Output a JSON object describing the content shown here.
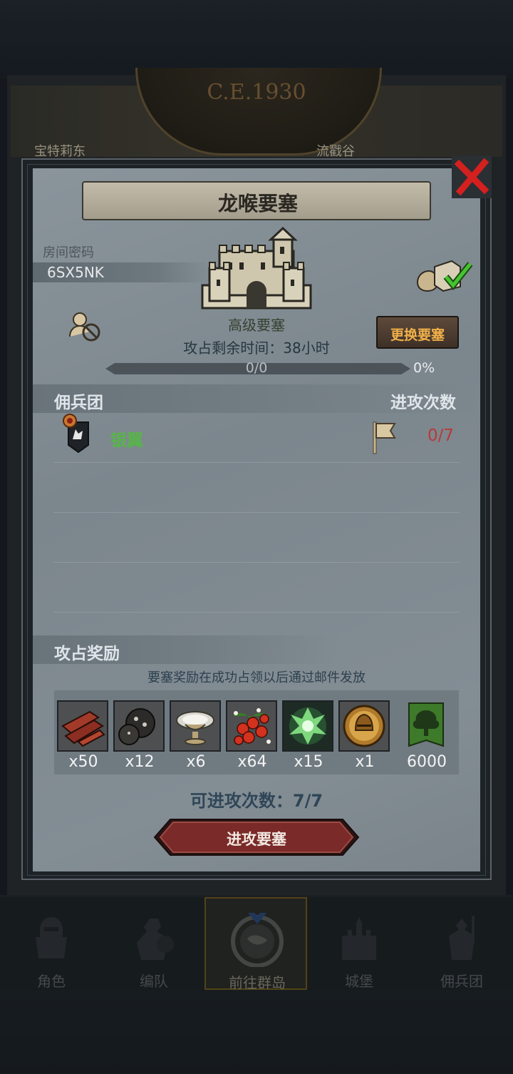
{
  "background": {
    "year": "C.E.1930",
    "label_left": "宝特莉东",
    "label_right": "流戳谷"
  },
  "nav": {
    "items": [
      {
        "label": "角色",
        "icon": "knight-icon"
      },
      {
        "label": "编队",
        "icon": "soldier-icon"
      },
      {
        "label": "前往群岛",
        "icon": "compass-icon"
      },
      {
        "label": "城堡",
        "icon": "castle-icon"
      },
      {
        "label": "佣兵团",
        "icon": "mercenary-icon"
      }
    ],
    "active": "前往群岛"
  },
  "dialog": {
    "title": "龙喉要塞",
    "room_label": "房间密码",
    "room_code": "6SX5NK",
    "fort_level": "高级要塞",
    "time_left": "攻占剩余时间：38小时",
    "progress_text": "0/0",
    "progress_percent_text": "0%",
    "progress_fraction": 0,
    "change_button": "更换要塞",
    "merc_header": "佣兵团",
    "attacks_header": "进攻次数",
    "mercenaries": [
      {
        "name": "银翼",
        "attacks": "0/7"
      }
    ],
    "rewards_header": "攻占奖励",
    "rewards_note": "要塞奖励在成功占领以后通过邮件发放",
    "rewards": [
      {
        "item": "wood-planks-icon",
        "qty": "x50"
      },
      {
        "item": "truffle-icon",
        "qty": "x12"
      },
      {
        "item": "silver-bowl-icon",
        "qty": "x6"
      },
      {
        "item": "berries-icon",
        "qty": "x64"
      },
      {
        "item": "forest-spirit-icon",
        "qty": "x15"
      },
      {
        "item": "golden-helmet-icon",
        "qty": "x1"
      },
      {
        "item": "tree-banner-icon",
        "qty": "6000"
      }
    ],
    "attack_count": "可进攻次数：7/7",
    "attack_button": "进攻要塞"
  },
  "colors": {
    "merc_name": "#58b44a",
    "attack_count_red": "#b73a3a",
    "change_button_text": "#f0b04a",
    "close_red": "#d4201e"
  }
}
